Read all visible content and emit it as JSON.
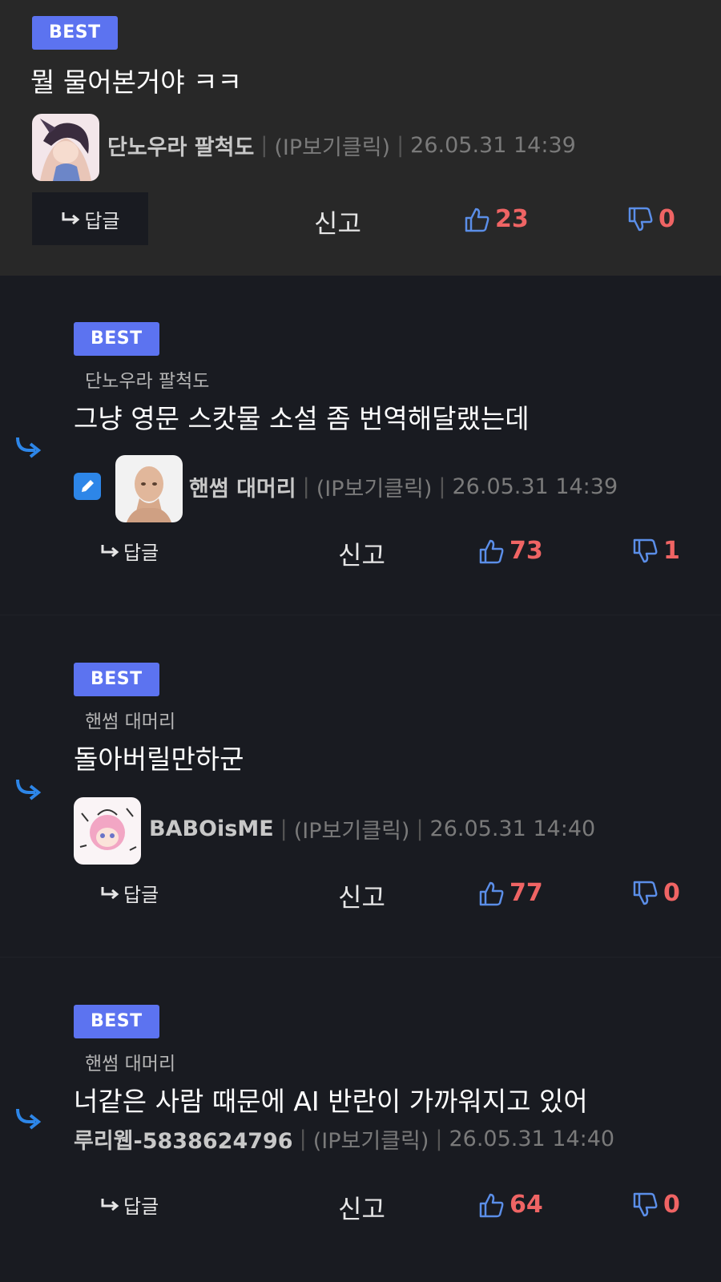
{
  "labels": {
    "best": "BEST",
    "reply": "답글",
    "report": "신고",
    "ip": "(IP보기클릭)",
    "sep": "|"
  },
  "colors": {
    "badge": "#5c73f0",
    "count": "#ef6464",
    "thumb": "#5b8ee8",
    "arrow": "#2d86e8"
  },
  "comments": [
    {
      "best": true,
      "reply_to": "",
      "text": "뭘 물어본거야 ㅋㅋ",
      "author": "단노우라 팔척도",
      "datetime": "26.05.31 14:39",
      "upvotes": "23",
      "downvotes": "0"
    },
    {
      "best": true,
      "reply_to": "단노우라 팔척도",
      "text": "그냥 영문 스캇물 소설 좀 번역해달랬는데",
      "author": "핸썸 대머리",
      "datetime": "26.05.31 14:39",
      "upvotes": "73",
      "downvotes": "1"
    },
    {
      "best": true,
      "reply_to": "핸썸 대머리",
      "text": "돌아버릴만하군",
      "author": "BABOisME",
      "datetime": "26.05.31 14:40",
      "upvotes": "77",
      "downvotes": "0"
    },
    {
      "best": true,
      "reply_to": "핸썸 대머리",
      "text": "너같은 사람 때문에 AI 반란이 가까워지고 있어",
      "author": "루리웹-5838624796",
      "datetime": "26.05.31 14:40",
      "upvotes": "64",
      "downvotes": "0"
    }
  ]
}
